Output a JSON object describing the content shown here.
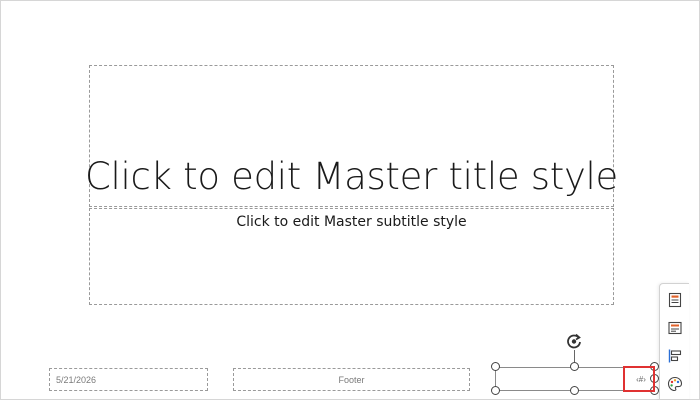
{
  "slide": {
    "title_placeholder": "Click to edit Master title style",
    "subtitle_placeholder": "Click to edit Master subtitle style",
    "date": "5/21/2026",
    "footer": "Footer",
    "slide_number": "‹#›"
  },
  "side_toolbar": {
    "items": [
      {
        "icon": "layout-format-icon"
      },
      {
        "icon": "text-box-icon"
      },
      {
        "icon": "align-left-icon"
      },
      {
        "icon": "palette-icon"
      }
    ]
  },
  "colors": {
    "highlight": "#e03131",
    "accent_orange": "#e0622a",
    "accent_blue": "#2b6fd6"
  }
}
